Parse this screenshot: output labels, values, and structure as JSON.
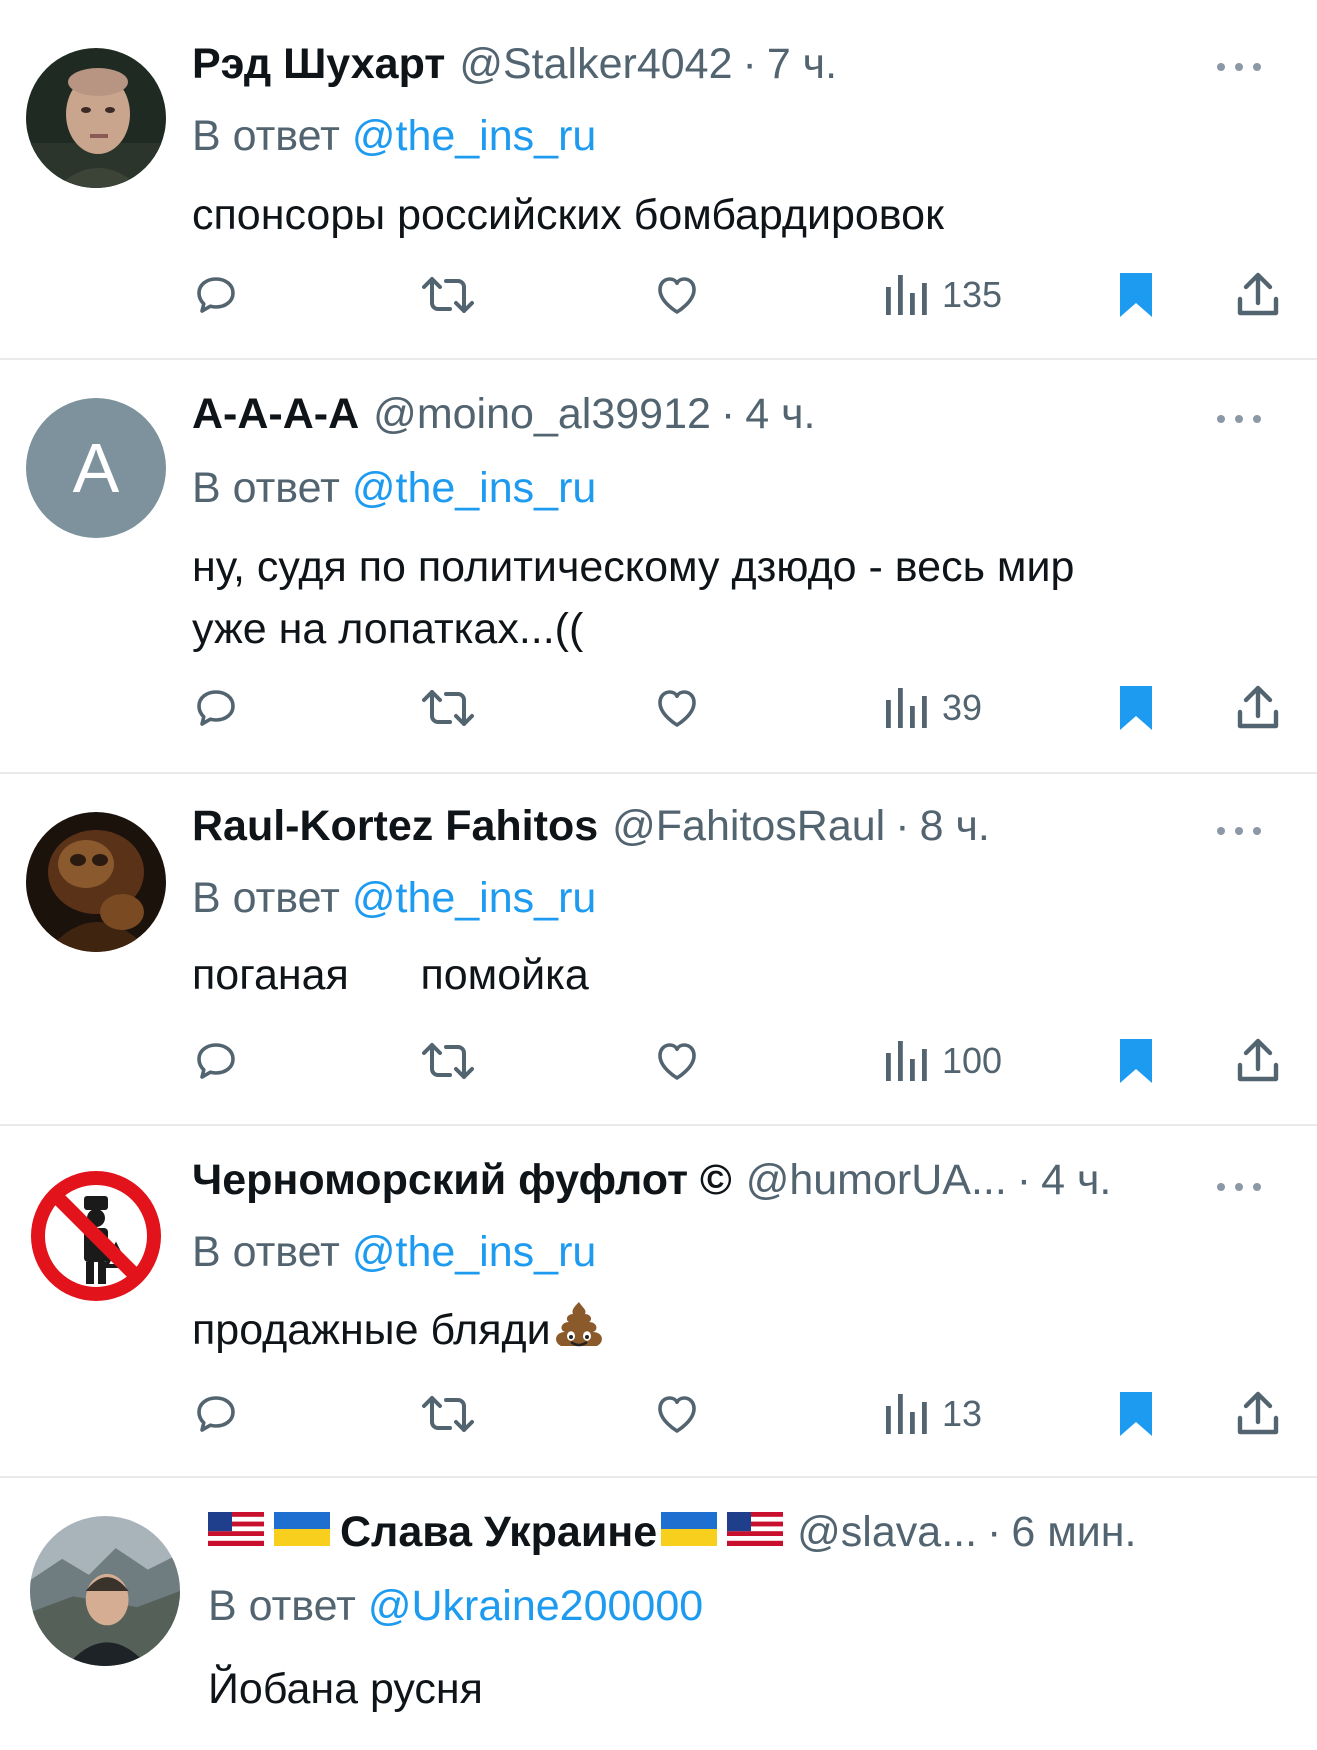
{
  "reply_prefix": "В ответ",
  "tweets": [
    {
      "name": "Рэд Шухарт",
      "handle": "@Stalker4042",
      "sep": "·",
      "time": "7 ч.",
      "reply_to": "@the_ins_ru",
      "text": "спонсоры российских бомбардировок",
      "views": "135",
      "avatar": "photo-man"
    },
    {
      "name": "А-А-А-А",
      "handle": "@moino_al39912",
      "sep": "·",
      "time": "4 ч.",
      "reply_to": "@the_ins_ru",
      "text": "ну, судя по политическому дзюдо - весь мир\nуже на лопатках...((",
      "views": "39",
      "avatar": "letter",
      "avatar_letter": "A",
      "avatar_color": "#7d929d"
    },
    {
      "name": "Raul-Kortez Fahitos",
      "handle": "@FahitosRaul",
      "sep": "·",
      "time": "8 ч.",
      "reply_to": "@the_ins_ru",
      "text": "поганая      помойка",
      "views": "100",
      "avatar": "photo-dark"
    },
    {
      "name": "Черноморский фуфлот ©",
      "handle": "@humorUA...",
      "sep": "·",
      "time": "4 ч.",
      "reply_to": "@the_ins_ru",
      "text": "продажные бляди",
      "text_emoji": "poop",
      "views": "13",
      "avatar": "prohibition-sign"
    },
    {
      "name": "Слава Украине",
      "name_flags_before": [
        "us-flag",
        "ua-flag"
      ],
      "name_flags_after": [
        "ua-flag",
        "us-flag"
      ],
      "handle": "@slava...",
      "sep": "·",
      "time": "6 мин.",
      "reply_to": "@Ukraine200000",
      "text": "Йобана русня",
      "avatar": "photo-outdoor"
    }
  ],
  "colors": {
    "accent": "#1d9bf0",
    "secondary_text": "#536471",
    "bookmark": "#1d9bf0",
    "divider": "#e8eaec"
  },
  "icons": [
    "reply-icon",
    "retweet-icon",
    "like-icon",
    "views-icon",
    "bookmark-icon",
    "share-icon",
    "more-icon"
  ]
}
